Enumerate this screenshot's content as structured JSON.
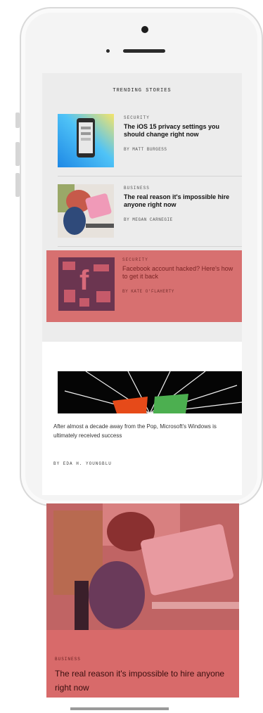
{
  "trending": {
    "title": "TRENDING STORIES",
    "stories": [
      {
        "category": "SECURITY",
        "headline": "The iOS 15 privacy settings you should change right now",
        "byline": "BY MATT BURGESS"
      },
      {
        "category": "BUSINESS",
        "headline": "The real reason it's impossible hire anyone right now",
        "byline": "BY MEGAN CARNEGIE"
      },
      {
        "category": "SECURITY",
        "headline": "Facebook account hacked? Here's how to get it back",
        "byline": "BY KATE O'FLAHERTY"
      }
    ]
  },
  "article2": {
    "text": "After almost a decade away from the Pop, Microsoft's Windows is ultimately received success",
    "byline": "BY EDA H. YOUNGBLU"
  },
  "featured": {
    "category": "BUSINESS",
    "headline": "The real reason it's impossible to hire anyone right now"
  },
  "colors": {
    "overlay": "#d45a5a",
    "trending_bg": "#ececec"
  }
}
